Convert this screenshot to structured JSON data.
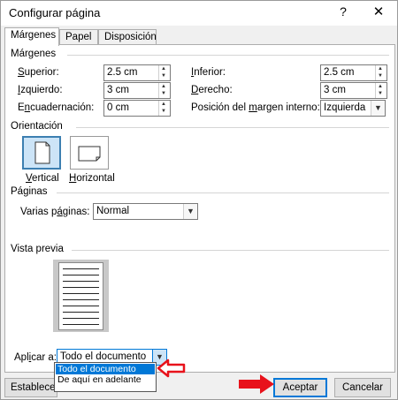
{
  "window": {
    "title": "Configurar página",
    "help_glyph": "?",
    "close_glyph": "✕"
  },
  "tabs": [
    {
      "label": "Márgenes"
    },
    {
      "label": "Papel"
    },
    {
      "label": "Disposición"
    }
  ],
  "margins": {
    "heading": "Márgenes",
    "top": {
      "label_u": "S",
      "label_rest": "uperior:",
      "value": "2.5 cm"
    },
    "left": {
      "label_u": "I",
      "label_rest": "zquierdo:",
      "value": "3 cm"
    },
    "gutter": {
      "label_pre": "E",
      "label_u": "n",
      "label_rest": "cuadernación:",
      "value": "0 cm"
    },
    "bottom": {
      "label_u": "I",
      "label_rest": "nferior:",
      "value": "2.5 cm"
    },
    "right": {
      "label_u": "D",
      "label_rest": "erecho:",
      "value": "3 cm"
    },
    "gutter_pos": {
      "label_pre": "Posición del ",
      "label_u": "m",
      "label_rest": "argen interno:",
      "value": "Izquierda"
    }
  },
  "orientation": {
    "heading": "Orientación",
    "vertical": {
      "label_u": "V",
      "label_rest": "ertical",
      "selected": true
    },
    "horizontal": {
      "label_u": "H",
      "label_rest": "orizontal",
      "selected": false
    }
  },
  "pages": {
    "heading": "Páginas",
    "multiple_label_pre": "Varias p",
    "multiple_label_u": "á",
    "multiple_label_rest": "ginas:",
    "multiple_value": "Normal"
  },
  "preview": {
    "heading": "Vista previa"
  },
  "apply": {
    "label_pre": "Apl",
    "label_u": "i",
    "label_rest": "car a:",
    "value": "Todo el documento",
    "options": [
      "Todo el documento",
      "De aquí en adelante"
    ],
    "highlighted_index": 0
  },
  "buttons": {
    "default_label": "Establecer c",
    "accept": "Aceptar",
    "cancel": "Cancelar"
  },
  "colors": {
    "accent": "#0078d7",
    "annotation_red": "#e8121b"
  }
}
